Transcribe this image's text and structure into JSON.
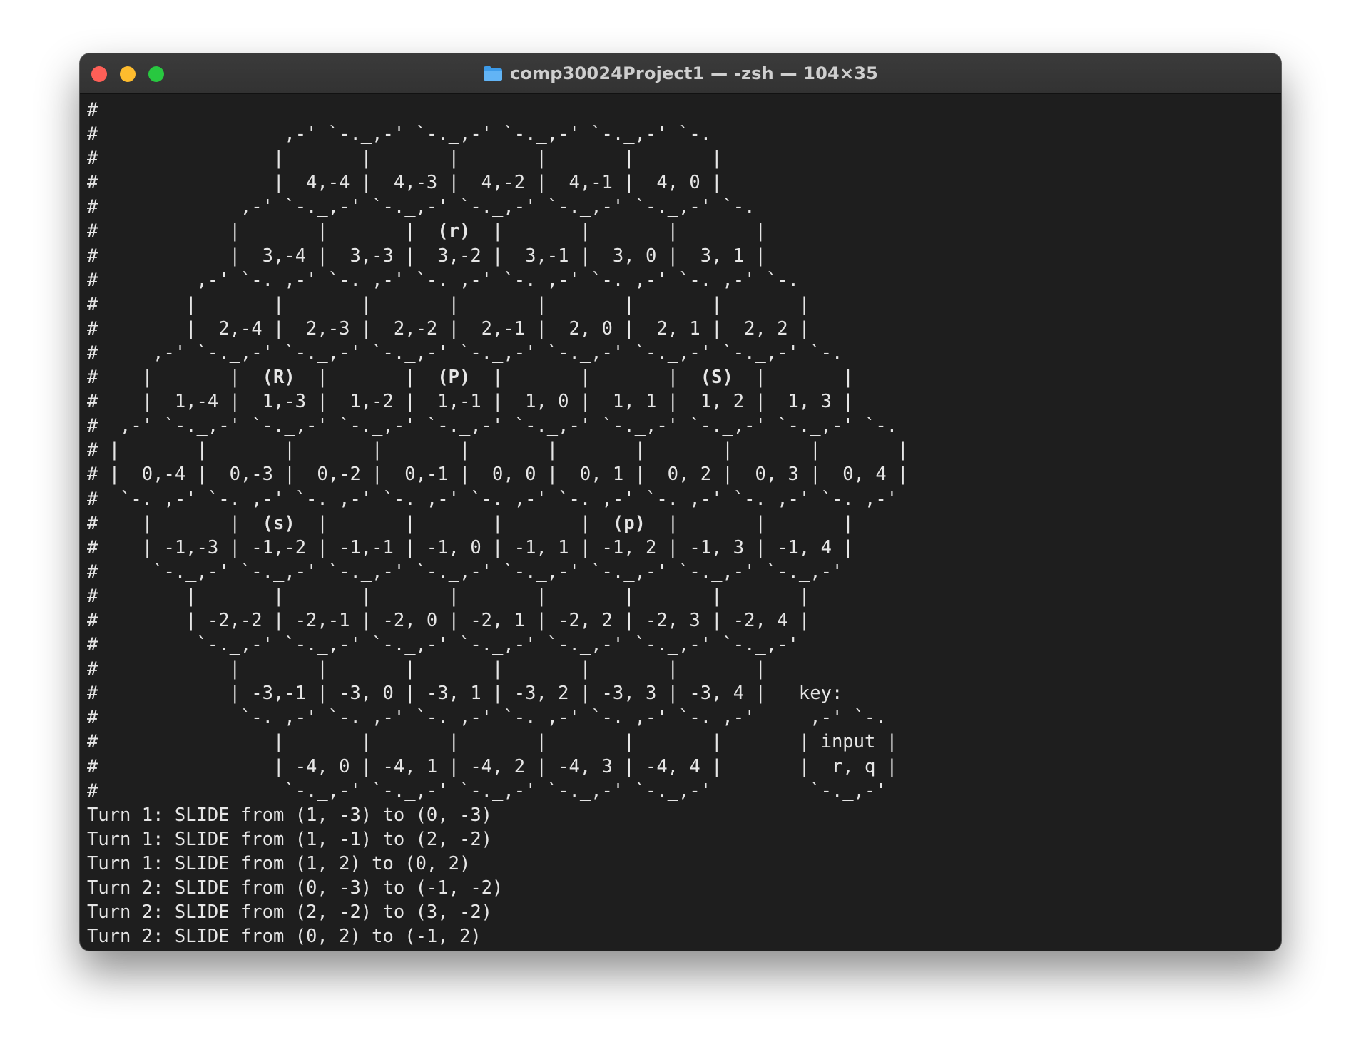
{
  "window": {
    "title": "comp30024Project1 — -zsh — 104×35",
    "icons": {
      "title": "folder-icon",
      "close": "close-button",
      "minimize": "minimize-button",
      "maximize": "maximize-button"
    },
    "colors": {
      "close": "#fe5f57",
      "minimize": "#febc2e",
      "maximize": "#28c840",
      "background": "#1e1e1e",
      "text": "#e6e6e6"
    }
  },
  "terminal": {
    "lines": [
      "#",
      "#                 ,-' `-._,-' `-._,-' `-._,-' `-._,-' `-.",
      "#                |       |       |       |       |       |",
      "#                |  4,-4 |  4,-3 |  4,-2 |  4,-1 |  4, 0 |",
      "#             ,-' `-._,-' `-._,-' `-._,-' `-._,-' `-._,-' `-.",
      "#            |       |       |  (r)  |       |       |       |",
      "#            |  3,-4 |  3,-3 |  3,-2 |  3,-1 |  3, 0 |  3, 1 |",
      "#         ,-' `-._,-' `-._,-' `-._,-' `-._,-' `-._,-' `-._,-' `-.",
      "#        |       |       |       |       |       |       |       |",
      "#        |  2,-4 |  2,-3 |  2,-2 |  2,-1 |  2, 0 |  2, 1 |  2, 2 |",
      "#     ,-' `-._,-' `-._,-' `-._,-' `-._,-' `-._,-' `-._,-' `-._,-' `-.",
      "#    |       |  (R)  |       |  (P)  |       |       |  (S)  |       |",
      "#    |  1,-4 |  1,-3 |  1,-2 |  1,-1 |  1, 0 |  1, 1 |  1, 2 |  1, 3 |",
      "#  ,-' `-._,-' `-._,-' `-._,-' `-._,-' `-._,-' `-._,-' `-._,-' `-._,-' `-.",
      "# |       |       |       |       |       |       |       |       |       |",
      "# |  0,-4 |  0,-3 |  0,-2 |  0,-1 |  0, 0 |  0, 1 |  0, 2 |  0, 3 |  0, 4 |",
      "#  `-._,-' `-._,-' `-._,-' `-._,-' `-._,-' `-._,-' `-._,-' `-._,-' `-._,-'",
      "#    |       |  (s)  |       |       |       |  (p)  |       |       |",
      "#    | -1,-3 | -1,-2 | -1,-1 | -1, 0 | -1, 1 | -1, 2 | -1, 3 | -1, 4 |",
      "#     `-._,-' `-._,-' `-._,-' `-._,-' `-._,-' `-._,-' `-._,-' `-._,-'",
      "#        |       |       |       |       |       |       |       |",
      "#        | -2,-2 | -2,-1 | -2, 0 | -2, 1 | -2, 2 | -2, 3 | -2, 4 |",
      "#         `-._,-' `-._,-' `-._,-' `-._,-' `-._,-' `-._,-' `-._,-'",
      "#            |       |       |       |       |       |       |",
      "#            | -3,-1 | -3, 0 | -3, 1 | -3, 2 | -3, 3 | -3, 4 |   key:",
      "#             `-._,-' `-._,-' `-._,-' `-._,-' `-._,-' `-._,-'     ,-' `-.",
      "#                |       |       |       |       |       |       | input |",
      "#                | -4, 0 | -4, 1 | -4, 2 | -4, 3 | -4, 4 |       |  r, q |",
      "#                 `-._,-' `-._,-' `-._,-' `-._,-' `-._,-'         `-._,-'",
      "Turn 1: SLIDE from (1, -3) to (0, -3)",
      "Turn 1: SLIDE from (1, -1) to (2, -2)",
      "Turn 1: SLIDE from (1, 2) to (0, 2)",
      "Turn 2: SLIDE from (0, -3) to (-1, -2)",
      "Turn 2: SLIDE from (2, -2) to (3, -2)",
      "Turn 2: SLIDE from (0, 2) to (-1, 2)"
    ]
  }
}
